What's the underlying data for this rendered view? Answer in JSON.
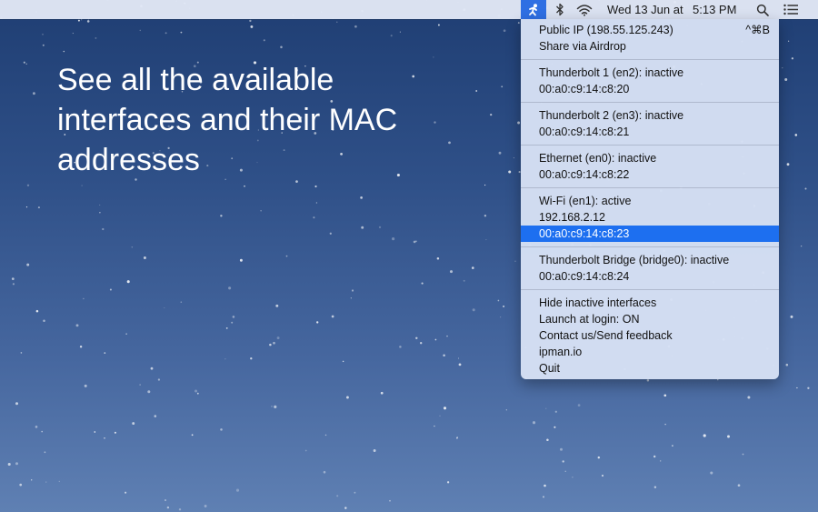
{
  "menubar": {
    "app_icon": "ipman-app-icon",
    "bluetooth_icon": "bluetooth-icon",
    "wifi_icon": "wifi-icon",
    "date": "Wed 13 Jun at",
    "time": "5:13 PM",
    "search_icon": "spotlight-search-icon",
    "notification_icon": "notification-center-icon"
  },
  "headline": "See all the available interfaces and their MAC addresses",
  "menu": {
    "public_ip": "Public IP (198.55.125.243)",
    "public_ip_shortcut": "^⌘B",
    "share_airdrop": "Share via Airdrop",
    "interfaces": [
      {
        "status": "Thunderbolt 1 (en2): inactive",
        "mac": "00:a0:c9:14:c8:20"
      },
      {
        "status": "Thunderbolt 2 (en3): inactive",
        "mac": "00:a0:c9:14:c8:21"
      },
      {
        "status": "Ethernet (en0): inactive",
        "mac": "00:a0:c9:14:c8:22"
      },
      {
        "status": "Wi-Fi (en1): active",
        "ip": "192.168.2.12",
        "mac": "00:a0:c9:14:c8:23"
      },
      {
        "status": "Thunderbolt Bridge (bridge0): inactive",
        "mac": "00:a0:c9:14:c8:24"
      }
    ],
    "actions": {
      "hide_inactive": "Hide inactive interfaces",
      "launch_login": "Launch at login: ON",
      "contact": "Contact us/Send feedback",
      "website": "ipman.io",
      "quit": "Quit"
    }
  },
  "colors": {
    "highlight": "#1d6ff0",
    "menubar_bg": "#e2e8f6",
    "menu_bg": "#d6e0f4"
  }
}
